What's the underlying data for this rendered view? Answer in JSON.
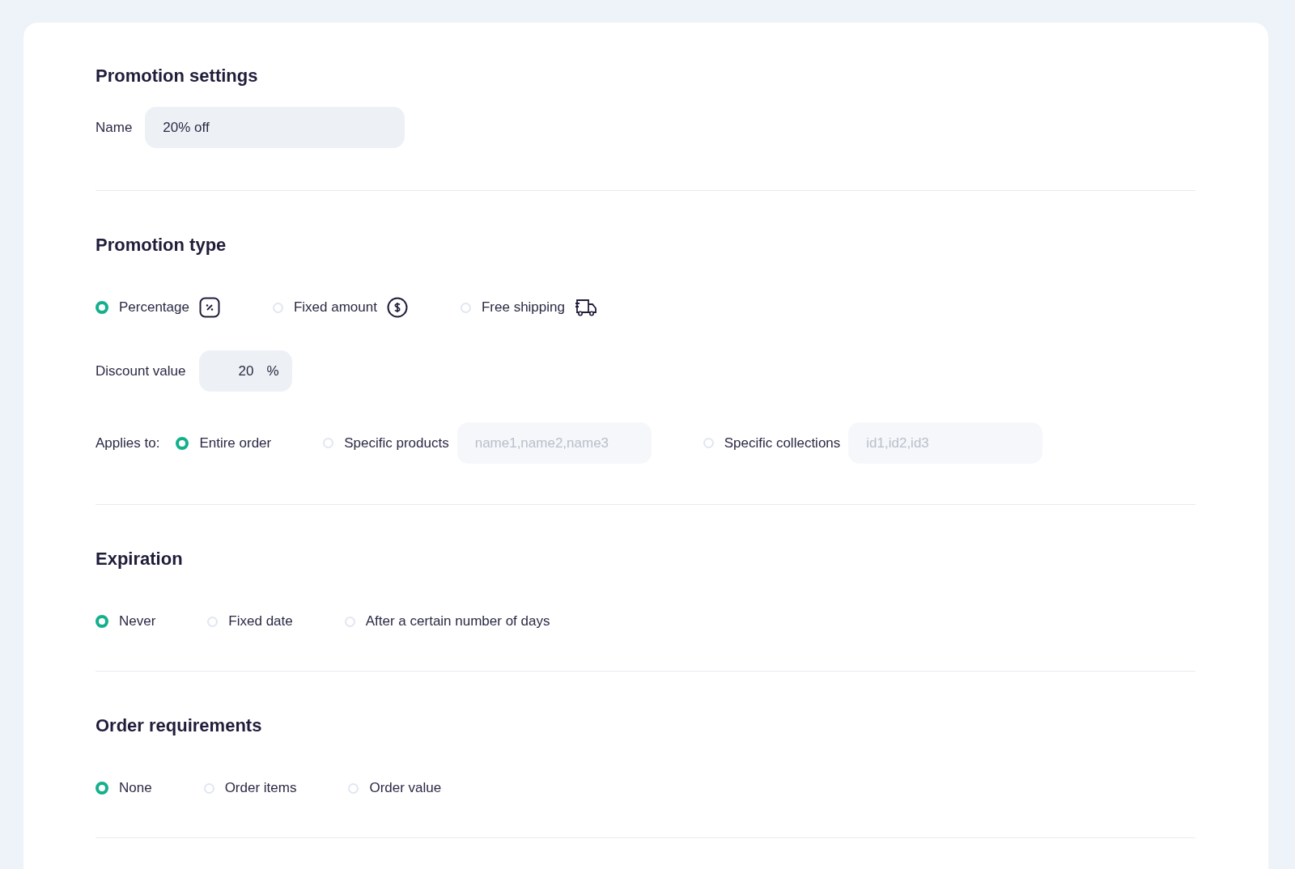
{
  "settings": {
    "title": "Promotion settings",
    "name_label": "Name",
    "name_value": "20% off"
  },
  "promotion_type": {
    "title": "Promotion type",
    "options": [
      {
        "label": "Percentage",
        "selected": true
      },
      {
        "label": "Fixed amount",
        "selected": false
      },
      {
        "label": "Free shipping",
        "selected": false
      }
    ],
    "discount_label": "Discount value",
    "discount_value": "20",
    "discount_unit": "%",
    "applies_label": "Applies to:",
    "applies_options": [
      {
        "label": "Entire order",
        "selected": true
      },
      {
        "label": "Specific products",
        "selected": false,
        "placeholder": "name1,name2,name3"
      },
      {
        "label": "Specific collections",
        "selected": false,
        "placeholder": "id1,id2,id3"
      }
    ]
  },
  "expiration": {
    "title": "Expiration",
    "options": [
      {
        "label": "Never",
        "selected": true
      },
      {
        "label": "Fixed date",
        "selected": false
      },
      {
        "label": "After a certain number of days",
        "selected": false
      }
    ]
  },
  "order_requirements": {
    "title": "Order requirements",
    "options": [
      {
        "label": "None",
        "selected": true
      },
      {
        "label": "Order items",
        "selected": false
      },
      {
        "label": "Order value",
        "selected": false
      }
    ]
  }
}
